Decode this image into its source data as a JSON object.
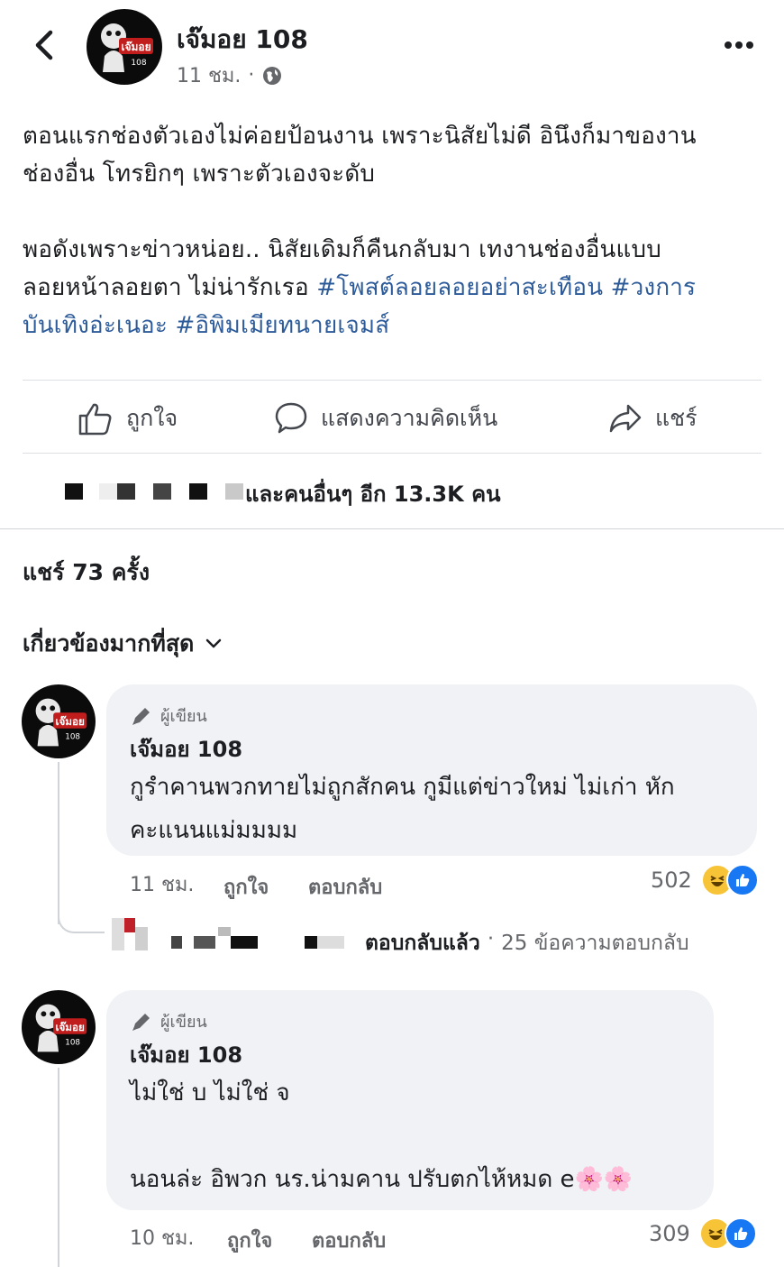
{
  "header": {
    "name": "เจ๊มอย 108",
    "time": "11 ชม.",
    "separator": "·",
    "back_icon": "chevron-left-icon",
    "more_icon": "more-dots-icon",
    "privacy_icon": "globe-icon"
  },
  "avatar": {
    "text": "เจ๊มอย",
    "sub": "108"
  },
  "post": {
    "line1": "ตอนแรกช่องตัวเองไม่ค่อยป้อนงาน เพราะนิสัยไม่ดี อินึงก็มาของาน",
    "line2": "ช่องอื่น โทรยิกๆ เพราะตัวเองจะดับ",
    "line3": "พอดังเพราะข่าวหน่อย.. นิสัยเดิมก็คืนกลับมา เทงานช่องอื่นแบบ",
    "line4_text": "ลอยหน้าลอยตา ไม่น่ารักเรอ ",
    "line4_tag1": "#โพสต์ลอยลอยอย่าสะเทือน",
    "line4_space": " ",
    "line4_tag2": "#วงการ",
    "line5_tag2_cont": "บันเทิงอ่ะเนอะ",
    "line5_space": " ",
    "line5_tag3": "#อิพิมเมียทนายเจมส์"
  },
  "actions": {
    "like": "ถูกใจ",
    "comment": "แสดงความคิดเห็น",
    "share": "แชร์"
  },
  "reactions_summary": "และคนอื่นๆ อีก 13.3K คน",
  "shares": "แชร์ 73 ครั้ง",
  "sort": {
    "label": "เกี่ยวข้องมากที่สุด"
  },
  "comments": [
    {
      "author_badge": "ผู้เขียน",
      "name": "เจ๊มอย 108",
      "line1": "กูรำคานพวกทายไม่ถูกสักคน กูมีแต่ข่าวใหม่ ไม่เก่า หัก",
      "line2": "คะแนนแม่มมมม",
      "time": "11 ชม.",
      "like": "ถูกใจ",
      "reply": "ตอบกลับ",
      "count": "502",
      "replies_text": "ตอบกลับแล้ว",
      "replies_sep": "·",
      "replies_count": "25 ข้อความตอบกลับ"
    },
    {
      "author_badge": "ผู้เขียน",
      "name": "เจ๊มอย 108",
      "line1": "ไม่ใช่ บ ไม่ใช่ จ",
      "line2": "นอนล่ะ อิพวก นร.น่ามคาน ปรับตกไห้หมด e",
      "emoji": "🌸🌸",
      "time": "10 ชม.",
      "like": "ถูกใจ",
      "reply": "ตอบกลับ",
      "count": "309"
    }
  ],
  "colors": {
    "hashtag": "#2d5b9a",
    "bubble": "#f0f2f5",
    "like_blue": "#1877f2",
    "haha_yellow": "#f7c438"
  }
}
